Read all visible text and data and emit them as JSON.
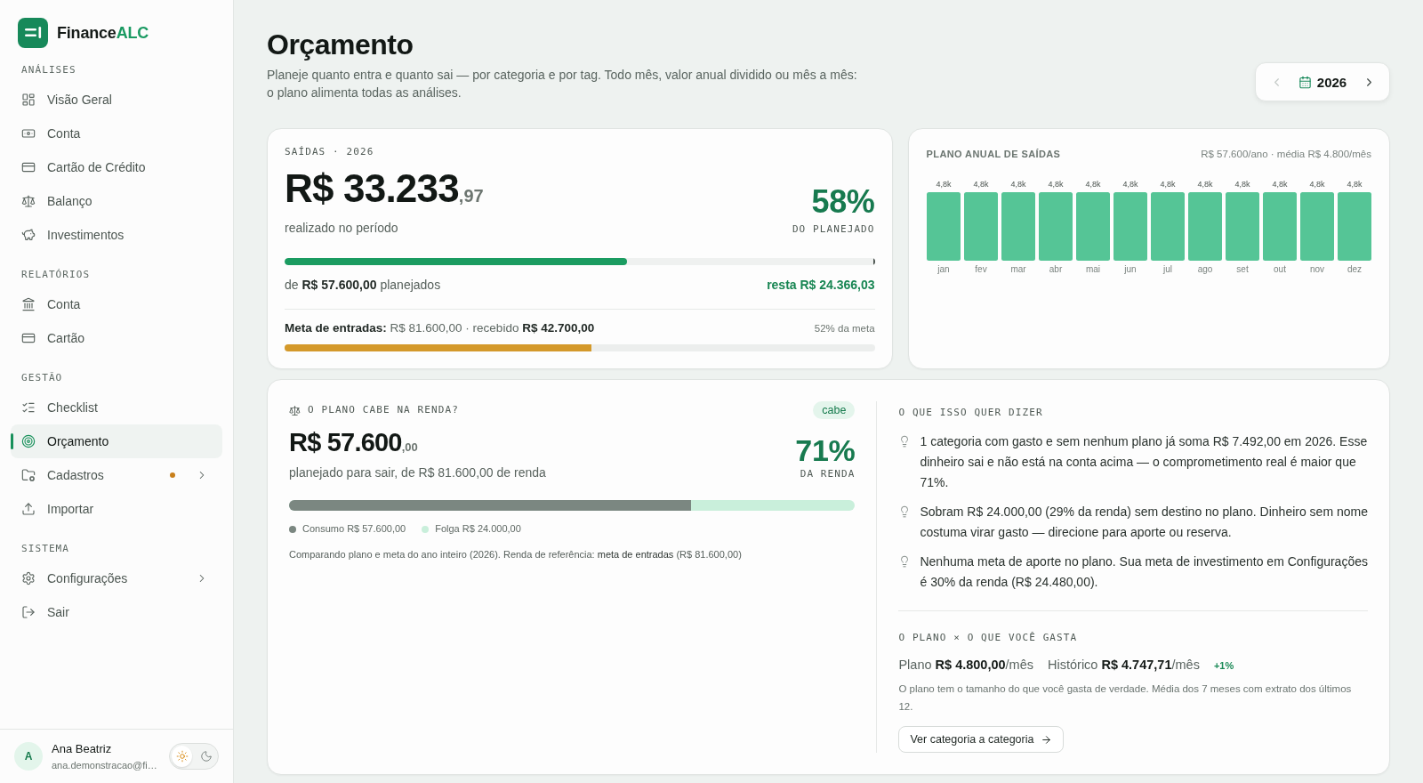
{
  "sidebar": {
    "brand": {
      "name": "Finance",
      "accent": "ALC"
    },
    "sections": [
      {
        "title": "ANÁLISES",
        "items": [
          {
            "label": "Visão Geral",
            "selected": false,
            "notification": false,
            "has_submenu": false
          },
          {
            "label": "Conta",
            "selected": false,
            "notification": false,
            "has_submenu": false
          },
          {
            "label": "Cartão de Crédito",
            "selected": false,
            "notification": false,
            "has_submenu": false
          },
          {
            "label": "Balanço",
            "selected": false,
            "notification": false,
            "has_submenu": false
          },
          {
            "label": "Investimentos",
            "selected": false,
            "notification": false,
            "has_submenu": false
          }
        ]
      },
      {
        "title": "RELATÓRIOS",
        "items": [
          {
            "label": "Conta",
            "selected": false,
            "notification": false,
            "has_submenu": false
          },
          {
            "label": "Cartão",
            "selected": false,
            "notification": false,
            "has_submenu": false
          }
        ]
      },
      {
        "title": "GESTÃO",
        "items": [
          {
            "label": "Checklist",
            "selected": false,
            "notification": false,
            "has_submenu": false
          },
          {
            "label": "Orçamento",
            "selected": true,
            "notification": false,
            "has_submenu": false
          },
          {
            "label": "Cadastros",
            "selected": false,
            "notification": true,
            "has_submenu": true
          },
          {
            "label": "Importar",
            "selected": false,
            "notification": false,
            "has_submenu": false
          }
        ]
      },
      {
        "title": "SISTEMA",
        "items": [
          {
            "label": "Configurações",
            "selected": false,
            "notification": false,
            "has_submenu": true
          },
          {
            "label": "Sair",
            "selected": false,
            "notification": false,
            "has_submenu": false
          }
        ]
      }
    ],
    "user": {
      "initial": "A",
      "name": "Ana Beatriz",
      "email": "ana.demonstracao@fi…"
    },
    "theme_toggle": [
      {
        "kind": "light",
        "selected": true
      },
      {
        "kind": "dark",
        "selected": false
      }
    ]
  },
  "header": {
    "title": "Orçamento",
    "subtitle": "Planeje quanto entra e quanto sai — por categoria e por tag. Todo mês, valor anual dividido ou mês a mês: o plano alimenta todas as análises.",
    "year_picker": {
      "year": "2026",
      "prev_disabled": true,
      "next_disabled": false
    }
  },
  "spending": {
    "label": "SAÍDAS · 2026",
    "amount": "R$ 33.233",
    "cents": ",97",
    "caption": "realizado no período",
    "percent": "58%",
    "percent_label": "DO PLANEJADO",
    "level": 0.58,
    "planned": "de **R$ 57.600,00** planejados",
    "remaining": "resta R$ 24.366,03",
    "income_goal": {
      "text": "**Meta de entradas:** R$ 81.600,00 · recebido **R$ 42.700,00**",
      "progress": "52% da meta",
      "level": 0.52
    }
  },
  "annual_plan": {
    "summary": "R$ 57.600/ano · média R$ 4.800/mês",
    "chart_data": {
      "type": "bar",
      "title": "PLANO ANUAL DE SAÍDAS",
      "categories": [
        "jan",
        "fev",
        "mar",
        "abr",
        "mai",
        "jun",
        "jul",
        "ago",
        "set",
        "out",
        "nov",
        "dez"
      ],
      "values": [
        4800,
        4800,
        4800,
        4800,
        4800,
        4800,
        4800,
        4800,
        4800,
        4800,
        4800,
        4800
      ],
      "ylim": [
        0,
        4800
      ],
      "data_labels": true,
      "value_labels": [
        "4,8k",
        "4,8k",
        "4,8k",
        "4,8k",
        "4,8k",
        "4,8k",
        "4,8k",
        "4,8k",
        "4,8k",
        "4,8k",
        "4,8k",
        "4,8k"
      ]
    }
  },
  "fit": {
    "title": "O PLANO CABE NA RENDA?",
    "badge": "cabe",
    "amount": "R$ 57.600",
    "cents": ",00",
    "caption": "planejado para sair, de R$ 81.600,00 de renda",
    "percent": "71%",
    "percent_label": "DA RENDA",
    "level": 0.71,
    "legend": [
      {
        "label": "Consumo R$ 57.600,00",
        "color": "#7b8781"
      },
      {
        "label": "Folga R$ 24.000,00",
        "color": "#c9efdb"
      }
    ],
    "note": "Comparando plano e meta do ano inteiro (2026). Renda de referência: **meta de entradas** (R$ 81.600,00)"
  },
  "insights": {
    "title": "O QUE ISSO QUER DIZER",
    "items": [
      "1 categoria com gasto e sem nenhum plano já soma R$ 7.492,00 em 2026. Esse dinheiro sai e não está na conta acima — o comprometimento real é maior que 71%.",
      "Sobram R$ 24.000,00 (29% da renda) sem destino no plano. Dinheiro sem nome costuma virar gasto — direcione para aporte ou reserva.",
      "Nenhuma meta de aporte no plano. Sua meta de investimento em Configurações é 30% da renda (R$ 24.480,00)."
    ]
  },
  "comparison": {
    "title": "O PLANO × O QUE VOCÊ GASTA",
    "plan": "Plano **R$ 4.800,00**/mês",
    "history": "Histórico **R$ 4.747,71**/mês",
    "delta": "+1%",
    "note": "O plano tem o tamanho do que você gasta de verdade. Média dos 7 meses com extrato dos últimos 12.",
    "button": "Ver categoria a categoria"
  }
}
